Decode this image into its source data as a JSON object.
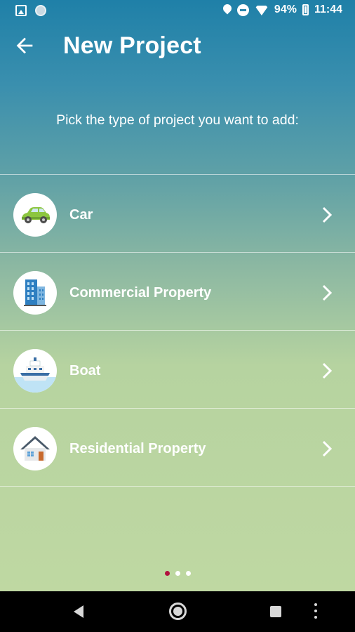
{
  "status_bar": {
    "battery": "94%",
    "time": "11:44",
    "icons": [
      "image-icon",
      "circle-icon",
      "location-pin-icon",
      "do-not-disturb-icon",
      "wifi-icon",
      "battery-icon"
    ]
  },
  "header": {
    "back_icon": "arrow-left-icon",
    "title": "New Project"
  },
  "prompt": "Pick the type of project you want to add:",
  "project_types": [
    {
      "label": "Car",
      "icon": "car-icon"
    },
    {
      "label": "Commercial Property",
      "icon": "office-building-icon"
    },
    {
      "label": "Boat",
      "icon": "boat-icon"
    },
    {
      "label": "Residential Property",
      "icon": "house-icon"
    }
  ],
  "pager": {
    "count": 3,
    "active_index": 0
  },
  "colors": {
    "header_top": "#1f80a8",
    "background_bottom": "#bfd8a2",
    "active_dot": "#b1123e"
  },
  "nav_bar": {
    "buttons": [
      "back-icon",
      "home-icon",
      "recent-apps-icon",
      "menu-icon"
    ]
  }
}
